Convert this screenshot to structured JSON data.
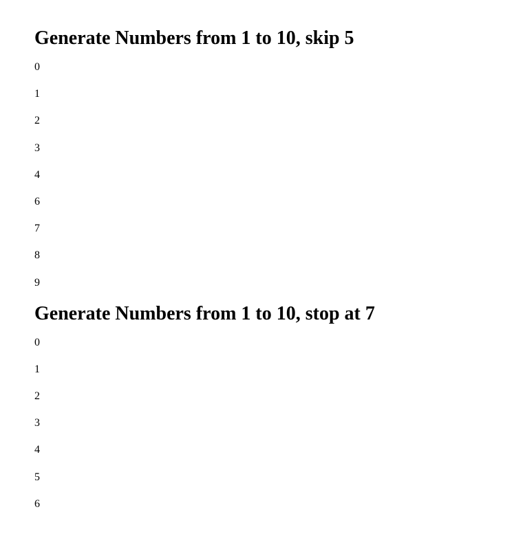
{
  "sections": [
    {
      "heading": "Generate Numbers from 1 to 10, skip 5",
      "numbers": [
        "0",
        "1",
        "2",
        "3",
        "4",
        "6",
        "7",
        "8",
        "9"
      ]
    },
    {
      "heading": "Generate Numbers from 1 to 10, stop at 7",
      "numbers": [
        "0",
        "1",
        "2",
        "3",
        "4",
        "5",
        "6"
      ]
    }
  ]
}
